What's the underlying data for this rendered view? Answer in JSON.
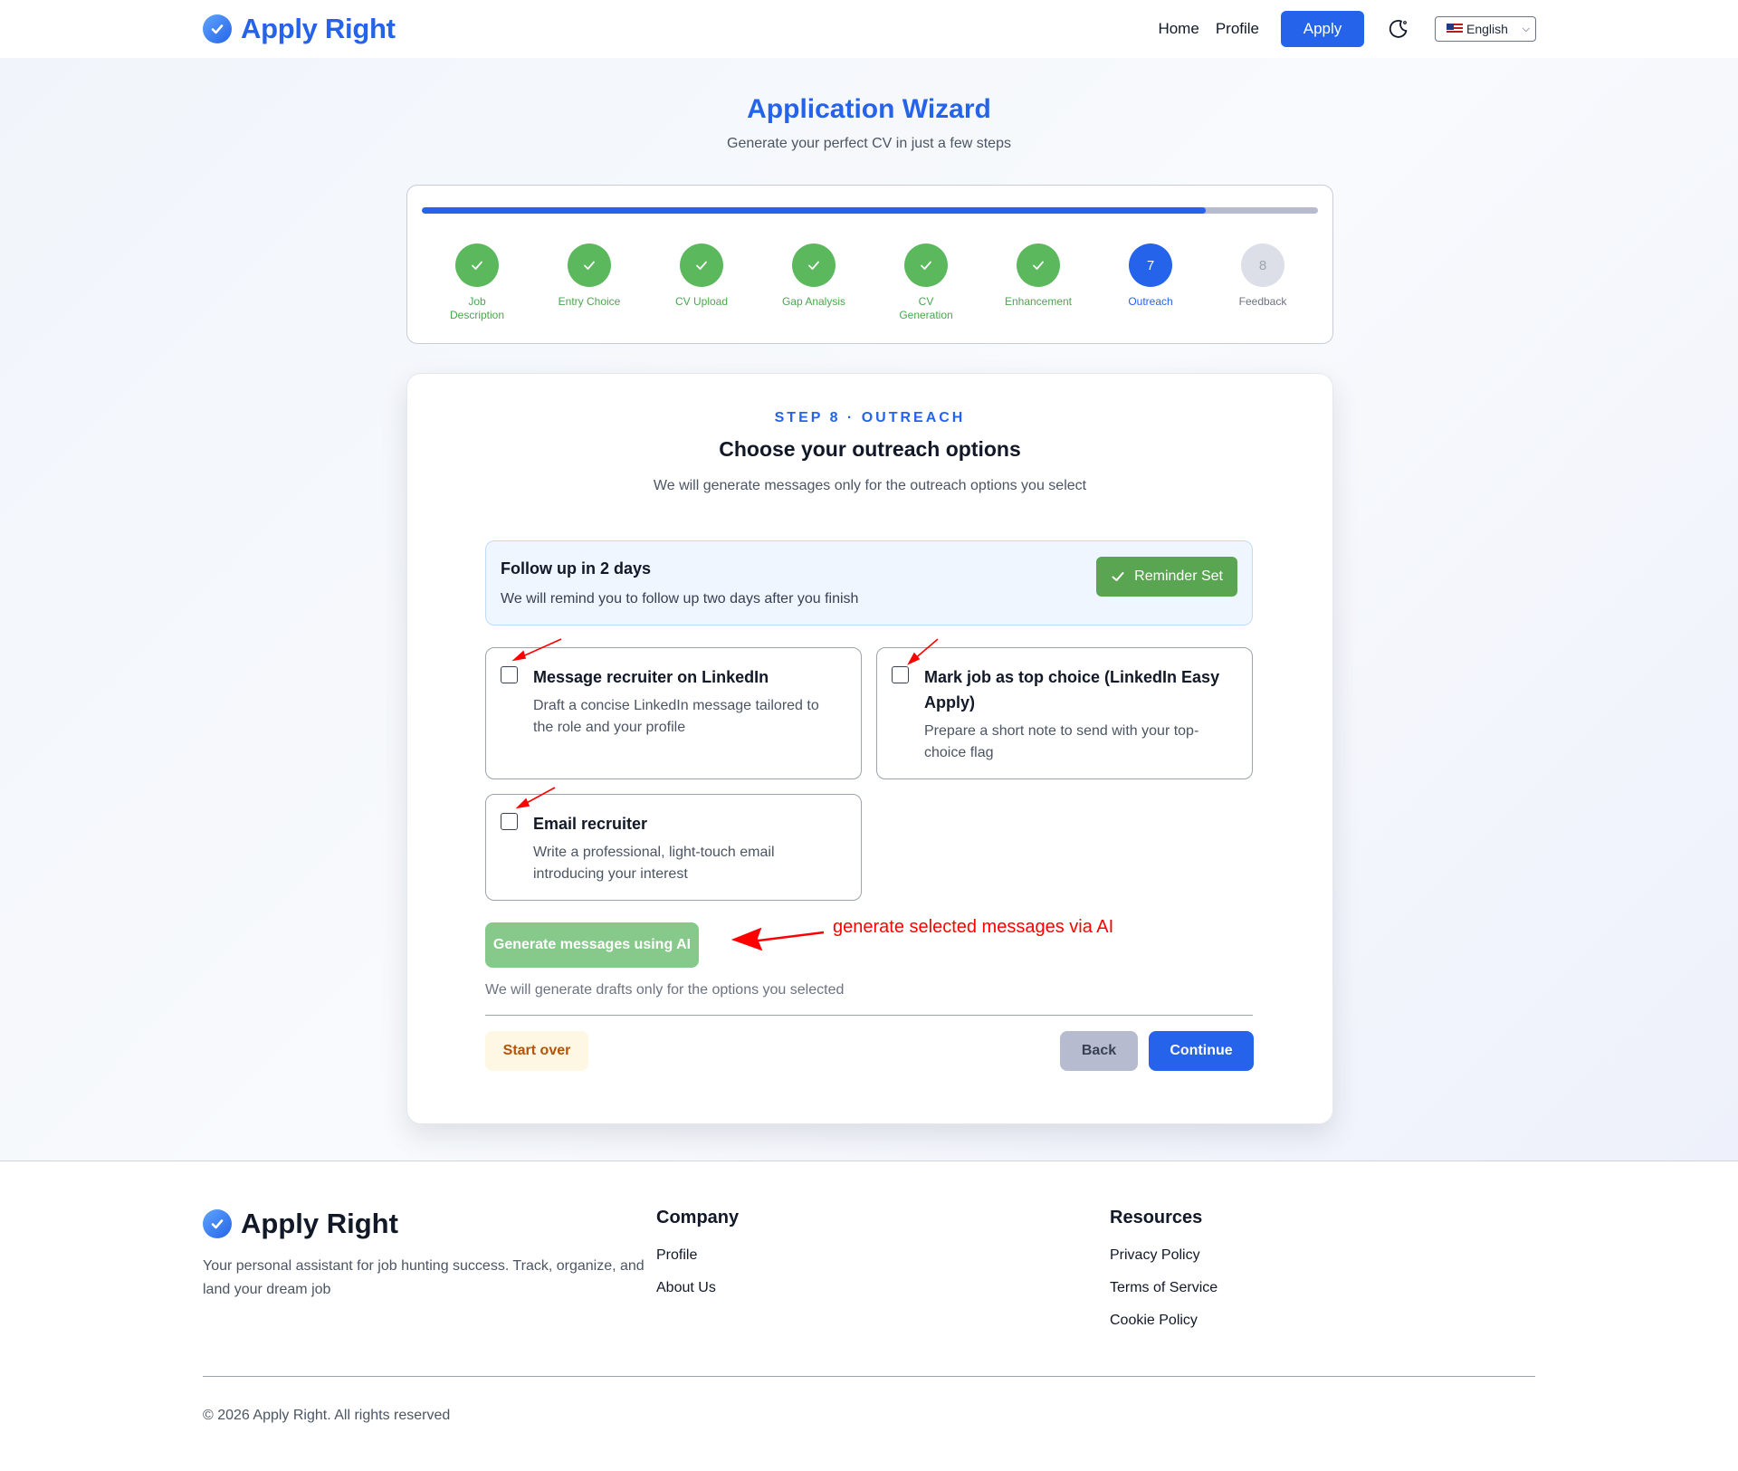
{
  "header": {
    "brand": "Apply Right",
    "nav": {
      "home": "Home",
      "profile": "Profile",
      "apply": "Apply"
    },
    "language": "English"
  },
  "wizard": {
    "title": "Application Wizard",
    "subtitle": "Generate your perfect CV in just a few steps",
    "progress_percent": 87.5,
    "steps": [
      {
        "number": "1",
        "label": "Job Description",
        "status": "done"
      },
      {
        "number": "2",
        "label": "Entry Choice",
        "status": "done"
      },
      {
        "number": "3",
        "label": "CV Upload",
        "status": "done"
      },
      {
        "number": "4",
        "label": "Gap Analysis",
        "status": "done"
      },
      {
        "number": "5",
        "label": "CV Generation",
        "status": "done"
      },
      {
        "number": "6",
        "label": "Enhancement",
        "status": "done"
      },
      {
        "number": "7",
        "label": "Outreach",
        "status": "active"
      },
      {
        "number": "8",
        "label": "Feedback",
        "status": "pending"
      }
    ]
  },
  "card": {
    "eyebrow": "STEP 8 · OUTREACH",
    "title": "Choose your outreach options",
    "subtitle": "We will generate messages only for the outreach options you select",
    "reminder": {
      "title": "Follow up in 2 days",
      "description": "We will remind you to follow up two days after you finish",
      "button": "Reminder Set"
    },
    "options": [
      {
        "title": "Message recruiter on LinkedIn",
        "description": "Draft a concise LinkedIn message tailored to the role and your profile",
        "checked": false
      },
      {
        "title": "Mark job as top choice (LinkedIn Easy Apply)",
        "description": "Prepare a short note to send with your top-choice flag",
        "checked": false
      },
      {
        "title": "Email recruiter",
        "description": "Write a professional, light-touch email introducing your interest",
        "checked": false
      }
    ],
    "ai_button": "Generate messages using AI",
    "ai_note": "We will generate drafts only for the options you selected",
    "start_over": "Start over",
    "back": "Back",
    "continue": "Continue"
  },
  "annotation": {
    "text": "generate selected messages via AI",
    "color": "#ff0000"
  },
  "footer": {
    "brand": "Apply Right",
    "description": "Your personal assistant for job hunting success. Track, organize, and land your dream job",
    "company": {
      "title": "Company",
      "links": [
        "Profile",
        "About Us"
      ]
    },
    "resources": {
      "title": "Resources",
      "links": [
        "Privacy Policy",
        "Terms of Service",
        "Cookie Policy"
      ]
    },
    "copyright": "© 2026 Apply Right. All rights reserved"
  },
  "colors": {
    "primary": "#2563eb",
    "success": "#5cb85c",
    "pending": "#dcdfe8"
  }
}
